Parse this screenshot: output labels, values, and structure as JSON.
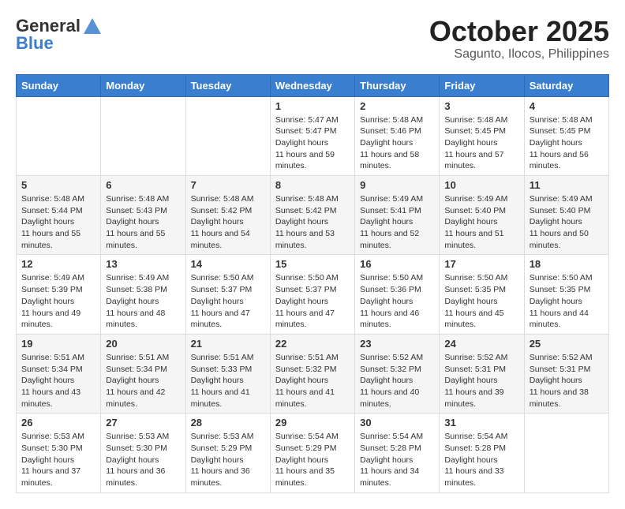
{
  "header": {
    "logo_general": "General",
    "logo_blue": "Blue",
    "month_title": "October 2025",
    "subtitle": "Sagunto, Ilocos, Philippines"
  },
  "weekdays": [
    "Sunday",
    "Monday",
    "Tuesday",
    "Wednesday",
    "Thursday",
    "Friday",
    "Saturday"
  ],
  "weeks": [
    [
      null,
      null,
      null,
      {
        "day": "1",
        "sunrise": "5:47 AM",
        "sunset": "5:47 PM",
        "daylight": "11 hours and 59 minutes."
      },
      {
        "day": "2",
        "sunrise": "5:48 AM",
        "sunset": "5:46 PM",
        "daylight": "11 hours and 58 minutes."
      },
      {
        "day": "3",
        "sunrise": "5:48 AM",
        "sunset": "5:45 PM",
        "daylight": "11 hours and 57 minutes."
      },
      {
        "day": "4",
        "sunrise": "5:48 AM",
        "sunset": "5:45 PM",
        "daylight": "11 hours and 56 minutes."
      }
    ],
    [
      {
        "day": "5",
        "sunrise": "5:48 AM",
        "sunset": "5:44 PM",
        "daylight": "11 hours and 55 minutes."
      },
      {
        "day": "6",
        "sunrise": "5:48 AM",
        "sunset": "5:43 PM",
        "daylight": "11 hours and 55 minutes."
      },
      {
        "day": "7",
        "sunrise": "5:48 AM",
        "sunset": "5:42 PM",
        "daylight": "11 hours and 54 minutes."
      },
      {
        "day": "8",
        "sunrise": "5:48 AM",
        "sunset": "5:42 PM",
        "daylight": "11 hours and 53 minutes."
      },
      {
        "day": "9",
        "sunrise": "5:49 AM",
        "sunset": "5:41 PM",
        "daylight": "11 hours and 52 minutes."
      },
      {
        "day": "10",
        "sunrise": "5:49 AM",
        "sunset": "5:40 PM",
        "daylight": "11 hours and 51 minutes."
      },
      {
        "day": "11",
        "sunrise": "5:49 AM",
        "sunset": "5:40 PM",
        "daylight": "11 hours and 50 minutes."
      }
    ],
    [
      {
        "day": "12",
        "sunrise": "5:49 AM",
        "sunset": "5:39 PM",
        "daylight": "11 hours and 49 minutes."
      },
      {
        "day": "13",
        "sunrise": "5:49 AM",
        "sunset": "5:38 PM",
        "daylight": "11 hours and 48 minutes."
      },
      {
        "day": "14",
        "sunrise": "5:50 AM",
        "sunset": "5:37 PM",
        "daylight": "11 hours and 47 minutes."
      },
      {
        "day": "15",
        "sunrise": "5:50 AM",
        "sunset": "5:37 PM",
        "daylight": "11 hours and 47 minutes."
      },
      {
        "day": "16",
        "sunrise": "5:50 AM",
        "sunset": "5:36 PM",
        "daylight": "11 hours and 46 minutes."
      },
      {
        "day": "17",
        "sunrise": "5:50 AM",
        "sunset": "5:35 PM",
        "daylight": "11 hours and 45 minutes."
      },
      {
        "day": "18",
        "sunrise": "5:50 AM",
        "sunset": "5:35 PM",
        "daylight": "11 hours and 44 minutes."
      }
    ],
    [
      {
        "day": "19",
        "sunrise": "5:51 AM",
        "sunset": "5:34 PM",
        "daylight": "11 hours and 43 minutes."
      },
      {
        "day": "20",
        "sunrise": "5:51 AM",
        "sunset": "5:34 PM",
        "daylight": "11 hours and 42 minutes."
      },
      {
        "day": "21",
        "sunrise": "5:51 AM",
        "sunset": "5:33 PM",
        "daylight": "11 hours and 41 minutes."
      },
      {
        "day": "22",
        "sunrise": "5:51 AM",
        "sunset": "5:32 PM",
        "daylight": "11 hours and 41 minutes."
      },
      {
        "day": "23",
        "sunrise": "5:52 AM",
        "sunset": "5:32 PM",
        "daylight": "11 hours and 40 minutes."
      },
      {
        "day": "24",
        "sunrise": "5:52 AM",
        "sunset": "5:31 PM",
        "daylight": "11 hours and 39 minutes."
      },
      {
        "day": "25",
        "sunrise": "5:52 AM",
        "sunset": "5:31 PM",
        "daylight": "11 hours and 38 minutes."
      }
    ],
    [
      {
        "day": "26",
        "sunrise": "5:53 AM",
        "sunset": "5:30 PM",
        "daylight": "11 hours and 37 minutes."
      },
      {
        "day": "27",
        "sunrise": "5:53 AM",
        "sunset": "5:30 PM",
        "daylight": "11 hours and 36 minutes."
      },
      {
        "day": "28",
        "sunrise": "5:53 AM",
        "sunset": "5:29 PM",
        "daylight": "11 hours and 36 minutes."
      },
      {
        "day": "29",
        "sunrise": "5:54 AM",
        "sunset": "5:29 PM",
        "daylight": "11 hours and 35 minutes."
      },
      {
        "day": "30",
        "sunrise": "5:54 AM",
        "sunset": "5:28 PM",
        "daylight": "11 hours and 34 minutes."
      },
      {
        "day": "31",
        "sunrise": "5:54 AM",
        "sunset": "5:28 PM",
        "daylight": "11 hours and 33 minutes."
      },
      null
    ]
  ]
}
